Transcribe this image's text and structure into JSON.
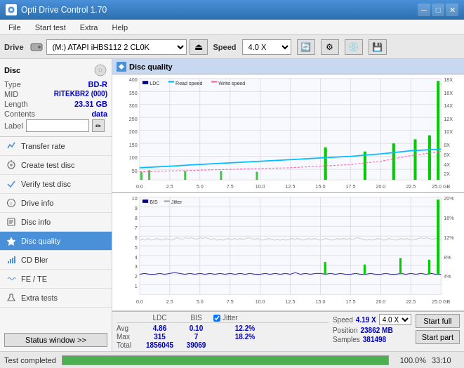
{
  "titleBar": {
    "title": "Opti Drive Control 1.70",
    "minBtn": "─",
    "maxBtn": "□",
    "closeBtn": "✕"
  },
  "menuBar": {
    "items": [
      "File",
      "Start test",
      "Extra",
      "Help"
    ]
  },
  "driveBar": {
    "driveLabel": "Drive",
    "driveValue": "(M:) ATAPI iHBS112  2 CL0K",
    "speedLabel": "Speed",
    "speedValue": "4.0 X"
  },
  "disc": {
    "title": "Disc",
    "typeLabel": "Type",
    "typeValue": "BD-R",
    "midLabel": "MID",
    "midValue": "RITEKBR2 (000)",
    "lengthLabel": "Length",
    "lengthValue": "23.31 GB",
    "contentsLabel": "Contents",
    "contentsValue": "data",
    "labelLabel": "Label"
  },
  "navItems": [
    {
      "id": "transfer-rate",
      "label": "Transfer rate",
      "icon": "📈"
    },
    {
      "id": "create-test-disc",
      "label": "Create test disc",
      "icon": "💿"
    },
    {
      "id": "verify-test-disc",
      "label": "Verify test disc",
      "icon": "✔"
    },
    {
      "id": "drive-info",
      "label": "Drive info",
      "icon": "ℹ"
    },
    {
      "id": "disc-info",
      "label": "Disc info",
      "icon": "📋"
    },
    {
      "id": "disc-quality",
      "label": "Disc quality",
      "icon": "★",
      "active": true
    },
    {
      "id": "cd-bler",
      "label": "CD Bler",
      "icon": "📊"
    },
    {
      "id": "fe-te",
      "label": "FE / TE",
      "icon": "〰"
    },
    {
      "id": "extra-tests",
      "label": "Extra tests",
      "icon": "🔧"
    }
  ],
  "statusBtn": "Status window >>",
  "chartTitle": "Disc quality",
  "chart1": {
    "legend": [
      "LDC",
      "Read speed",
      "Write speed"
    ],
    "yAxisMax": 400,
    "yAxisLabels": [
      "400",
      "350",
      "300",
      "250",
      "200",
      "150",
      "100",
      "50"
    ],
    "yAxisRight": [
      "18X",
      "16X",
      "14X",
      "12X",
      "10X",
      "8X",
      "6X",
      "4X",
      "2X"
    ],
    "xAxisLabels": [
      "0.0",
      "2.5",
      "5.0",
      "7.5",
      "10.0",
      "12.5",
      "15.0",
      "17.5",
      "20.0",
      "22.5",
      "25.0 GB"
    ]
  },
  "chart2": {
    "legend": [
      "BIS",
      "Jitter"
    ],
    "yAxisMax": 10,
    "yAxisLabels": [
      "10",
      "9",
      "8",
      "7",
      "6",
      "5",
      "4",
      "3",
      "2",
      "1"
    ],
    "yAxisRight": [
      "20%",
      "16%",
      "12%",
      "8%",
      "4%"
    ],
    "xAxisLabels": [
      "0.0",
      "2.5",
      "5.0",
      "7.5",
      "10.0",
      "12.5",
      "15.0",
      "17.5",
      "20.0",
      "22.5",
      "25.0 GB"
    ]
  },
  "stats": {
    "headers": [
      "",
      "LDC",
      "BIS",
      "Jitter",
      "Speed"
    ],
    "avg": {
      "label": "Avg",
      "ldc": "4.86",
      "bis": "0.10",
      "jitter": "12.2%",
      "speed": "4.19 X"
    },
    "max": {
      "label": "Max",
      "ldc": "315",
      "bis": "7",
      "jitter": "18.2%"
    },
    "total": {
      "label": "Total",
      "ldc": "1856045",
      "bis": "39069"
    },
    "jitterCheck": "Jitter",
    "speedDropdown": "4.0 X",
    "positionLabel": "Position",
    "positionValue": "23862 MB",
    "samplesLabel": "Samples",
    "samplesValue": "381498",
    "startFullBtn": "Start full",
    "startPartBtn": "Start part"
  },
  "progressBar": {
    "label": "Test completed",
    "percent": 100,
    "percentText": "100.0%",
    "time": "33:10"
  }
}
